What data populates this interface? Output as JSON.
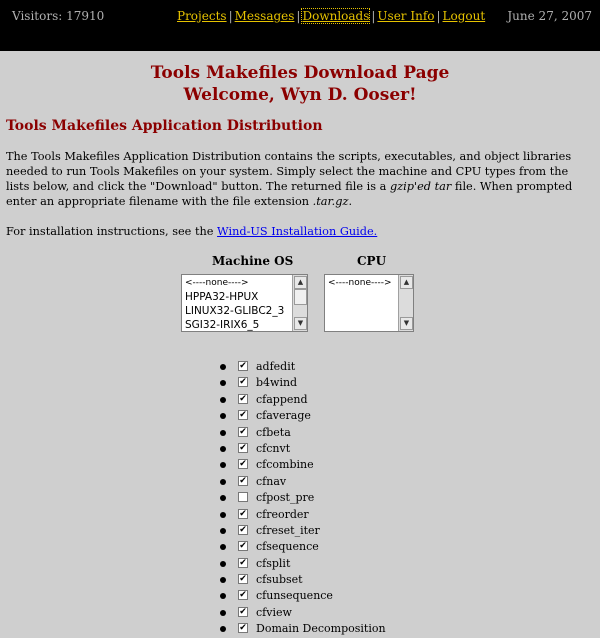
{
  "topbar": {
    "visitors": "Visitors: 17910",
    "nav": [
      {
        "label": "Projects"
      },
      {
        "label": "Messages"
      },
      {
        "label": "Downloads"
      },
      {
        "label": "User Info"
      },
      {
        "label": "Logout"
      }
    ],
    "date": "June 27, 2007"
  },
  "heading": {
    "title": "Tools Makefiles Download Page",
    "welcome": "Welcome, Wyn D. Ooser!"
  },
  "section_title": "Tools Makefiles Application Distribution",
  "description": {
    "part1": "The Tools Makefiles Application Distribution contains the scripts, executables, and object libraries needed to run Tools Makefiles on your system. Simply select the machine and CPU types from the lists below, and click the \"Download\" button. The returned file is a ",
    "file_type": "gzip'ed tar",
    "part2": " file. When prompted enter an appropriate filename with the file extension ",
    "extension": ".tar.gz",
    "part3": "."
  },
  "install": {
    "text": "For installation instructions, see the ",
    "link": "Wind-US Installation Guide."
  },
  "machine_os": {
    "label": "Machine OS",
    "options": [
      "<----none---->",
      "HPPA32-HPUX",
      "LINUX32-GLIBC2_3",
      "SGI32-IRIX6_5"
    ]
  },
  "cpu": {
    "label": "CPU",
    "options": [
      "<----none---->"
    ]
  },
  "modules": [
    {
      "name": "adfedit",
      "checked": true
    },
    {
      "name": "b4wind",
      "checked": true
    },
    {
      "name": "cfappend",
      "checked": true
    },
    {
      "name": "cfaverage",
      "checked": true
    },
    {
      "name": "cfbeta",
      "checked": true
    },
    {
      "name": "cfcnvt",
      "checked": true
    },
    {
      "name": "cfcombine",
      "checked": true
    },
    {
      "name": "cfnav",
      "checked": true
    },
    {
      "name": "cfpost_pre",
      "checked": false
    },
    {
      "name": "cfreorder",
      "checked": true
    },
    {
      "name": "cfreset_iter",
      "checked": true
    },
    {
      "name": "cfsequence",
      "checked": true
    },
    {
      "name": "cfsplit",
      "checked": true
    },
    {
      "name": "cfsubset",
      "checked": true
    },
    {
      "name": "cfunsequence",
      "checked": true
    },
    {
      "name": "cfview",
      "checked": true
    },
    {
      "name": "Domain Decomposition",
      "checked": true
    }
  ]
}
